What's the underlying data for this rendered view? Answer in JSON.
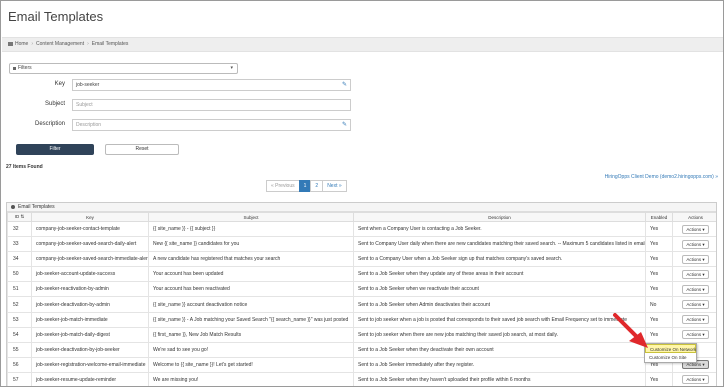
{
  "page": {
    "title": "Email Templates"
  },
  "breadcrumb": [
    "Home",
    "Content Management",
    "Email Templates"
  ],
  "filters": {
    "label": "Filters",
    "key_label": "Key",
    "key_value": "job-seeker",
    "subject_label": "Subject",
    "subject_placeholder": "Subject",
    "description_label": "Description",
    "description_placeholder": "Description",
    "filter_button": "Filter",
    "reset_button": "Reset"
  },
  "results": {
    "count_text": "27 Items Found",
    "client_link": "HiringOpps Client Demo (demo2.hiringopps.com) »"
  },
  "pagination": {
    "prev": "« Previous",
    "pages": [
      "1",
      "2"
    ],
    "next": "Next »",
    "active": "1"
  },
  "panel": {
    "title": "Email Templates"
  },
  "table": {
    "headers": [
      "ID",
      "Key",
      "Subject",
      "Description",
      "Enabled",
      "Actions"
    ],
    "rows": [
      {
        "id": "32",
        "key": "company-job-seeker-contact-template",
        "subject": "{{ site_name }} - {{ subject }}",
        "description": "Sent when a Company User is contacting a Job Seeker.",
        "enabled": "Yes",
        "action": "Actions ▾"
      },
      {
        "id": "33",
        "key": "company-job-seeker-saved-search-daily-alert",
        "subject": "New {{ site_name }} candidates for you",
        "description": "Sent to Company User daily when there are new candidates matching their saved search. -- Maximum 5 candidates listed in email.",
        "enabled": "Yes",
        "action": "Actions ▾"
      },
      {
        "id": "34",
        "key": "company-job-seeker-saved-search-immediate-alert",
        "subject": "A new candidate has registered that matches your search",
        "description": "Sent to a Company User when a Job Seeker sign up that matches company's saved search.",
        "enabled": "Yes",
        "action": "Actions ▾"
      },
      {
        "id": "50",
        "key": "job-seeker-account-update-success",
        "subject": "Your account has been updated",
        "description": "Sent to a Job Seeker when they update any of these areas in their account",
        "enabled": "Yes",
        "action": "Actions ▾"
      },
      {
        "id": "51",
        "key": "job-seeker-reactivation-by-admin",
        "subject": "Your account has been reactivated",
        "description": "Sent to a Job Seeker when we reactivate their account",
        "enabled": "Yes",
        "action": "Actions ▾"
      },
      {
        "id": "52",
        "key": "job-seeker-deactivation-by-admin",
        "subject": "{{ site_name }} account deactivation notice",
        "description": "Sent to a Job Seeker when Admin deactivates their account",
        "enabled": "No",
        "action": "Actions ▾"
      },
      {
        "id": "53",
        "key": "job-seeker-job-match-immediate",
        "subject": "{{ site_name }} - A Job matching your Saved Search \"{{ search_name }}\" was just posted",
        "description": "Sent to job seeker when a job is posted that corresponds to their saved job search with Email Frequency set to immediate",
        "enabled": "Yes",
        "action": "Actions ▾"
      },
      {
        "id": "54",
        "key": "job-seeker-job-match-daily-digest",
        "subject": "{{ first_name }}, New Job Match Results",
        "description": "Sent to job seeker when there are new jobs matching their saved job search, at most daily.",
        "enabled": "Yes",
        "action": "Actions ▾"
      },
      {
        "id": "55",
        "key": "job-seeker-deactivation-by-job-seeker",
        "subject": "We're sad to see you go!",
        "description": "Sent to a Job Seeker when they deactivate their own account",
        "enabled": "Yes",
        "action": ""
      },
      {
        "id": "56",
        "key": "job-seeker-registration-welcome-email-immediate",
        "subject": "Welcome to {{ site_name }}! Let's get started!",
        "description": "Sent to a Job Seeker immediately after they register.",
        "enabled": "Yes",
        "action": "Actions ▾"
      },
      {
        "id": "57",
        "key": "job-seeker-resume-update-reminder",
        "subject": "We are missing you!",
        "description": "Sent to a Job Seeker when they haven't uploaded their profile within 6 months",
        "enabled": "Yes",
        "action": "Actions ▾"
      }
    ]
  },
  "dropdown": {
    "items": [
      "Customize On Network",
      "Customize On Site"
    ],
    "active": "Customize On Network"
  },
  "colors": {
    "primary_dark": "#2f4359",
    "link": "#337ab7",
    "arrow": "#e0282b",
    "highlight": "#fff6a8"
  }
}
